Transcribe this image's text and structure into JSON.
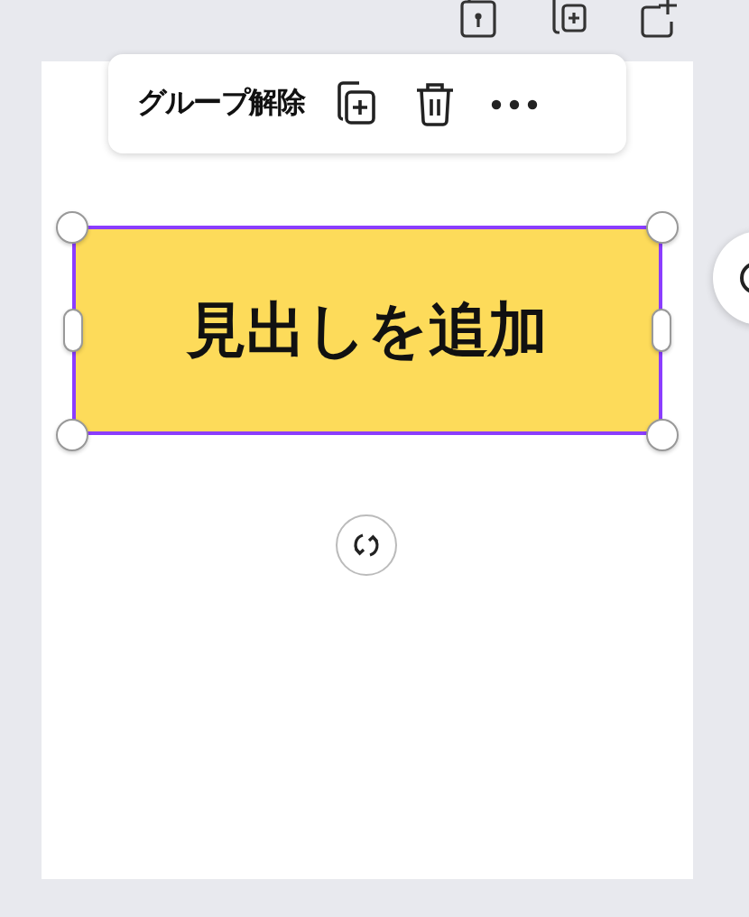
{
  "toolbar": {
    "label": "グループ解除"
  },
  "element": {
    "text": "見出しを追加",
    "selected": true
  }
}
